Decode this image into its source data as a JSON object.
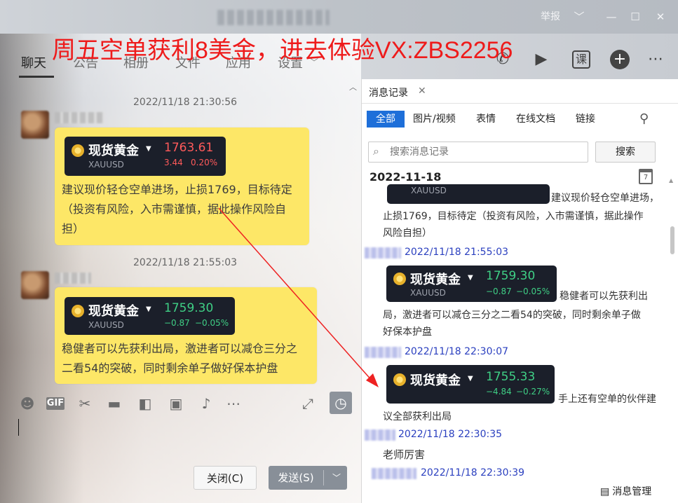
{
  "window": {
    "report_label": "举报",
    "controls": [
      "﹀",
      "—",
      "☐",
      "✕"
    ]
  },
  "promo_banner": "周五空单获利8美金，进去体验VX:ZBS2256",
  "tabs": [
    "聊天",
    "公告",
    "相册",
    "文件",
    "应用",
    "设置"
  ],
  "chat": {
    "messages": [
      {
        "timestamp": "2022/11/18 21:30:56",
        "quote": {
          "name": "现货黄金",
          "symbol": "XAUUSD",
          "price": "1763.61",
          "change": "3.44",
          "pct": "0.20%",
          "color": "#ff5a5a"
        },
        "text_lines": [
          "建议现价轻仓空单进场，止损1769，目标待定",
          "（投资有风险，入市需谨慎，据此操作风险自",
          "担）"
        ]
      },
      {
        "timestamp": "2022/11/18 21:55:03",
        "quote": {
          "name": "现货黄金",
          "symbol": "XAUUSD",
          "price": "1759.30",
          "change": "−0.87",
          "pct": "−0.05%",
          "color": "#3fcf85"
        },
        "text_lines": [
          "稳健者可以先获利出局，激进者可以减仓三分之",
          "二看54的突破，同时剩余单子做好保本护盘"
        ]
      }
    ],
    "toolbar_icons": [
      "emoji-icon",
      "gif-icon",
      "scissors-icon",
      "folder-icon",
      "clipboard-icon",
      "image-icon",
      "bell-icon",
      "more-icon",
      "expand-icon",
      "history-icon"
    ],
    "gif_label": "GIF",
    "close_label": "关闭(C)",
    "send_label": "发送(S)"
  },
  "record": {
    "tab_label": "消息记录",
    "filters": [
      "全部",
      "图片/视频",
      "表情",
      "在线文档",
      "链接"
    ],
    "search_placeholder": "搜索消息记录",
    "search_button": "搜索",
    "date": "2022-11-18",
    "calendar_day": "7",
    "partial_symbol": "XAUUSD",
    "partial_prefix": "建议现价轻仓空单进场，",
    "partial_lines": [
      "止损1769，目标待定（投资有风险，入市需谨慎，据此操作",
      "风险自担）"
    ],
    "items": [
      {
        "timestamp": "2022/11/18 21:55:03",
        "quote": {
          "name": "现货黄金",
          "symbol": "XAUUSD",
          "price": "1759.30",
          "change": "−0.87",
          "pct": "−0.05%",
          "color": "#3fcf85"
        },
        "inline": "稳健者可以先获利出",
        "lines": [
          "局，激进者可以减仓三分之二看54的突破，同时剩余单子做",
          "好保本护盘"
        ]
      },
      {
        "timestamp": "2022/11/18 22:30:07",
        "quote": {
          "name": "现货黄金",
          "symbol": "XAUUSD",
          "price": "1755.33",
          "change": "−4.84",
          "pct": "−0.27%",
          "color": "#3fcf85"
        },
        "inline": "手上还有空单的伙伴建",
        "lines": [
          "议全部获利出局"
        ]
      },
      {
        "timestamp": "2022/11/18 22:30:35",
        "text": "老师厉害"
      },
      {
        "timestamp": "2022/11/18 22:30:39"
      }
    ],
    "manage_label": "消息管理"
  },
  "colors": {
    "accent": "#1e6fd9",
    "bubble": "#fde767",
    "promo": "#ee1b1b",
    "timestamp_link": "#2a3fbf"
  }
}
